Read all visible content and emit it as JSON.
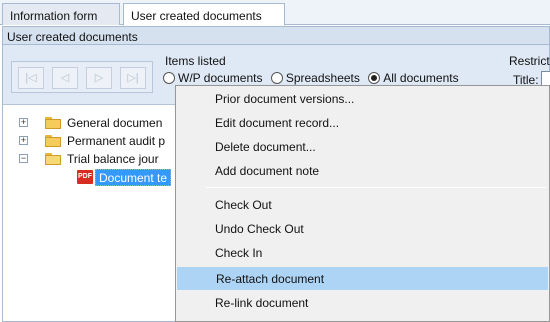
{
  "tabs": [
    {
      "label": "Information form",
      "active": false
    },
    {
      "label": "User created documents",
      "active": true,
      "caret": "▼"
    }
  ],
  "panel": {
    "title": "User created documents",
    "items_listed_label": "Items listed",
    "restricted_label": "Restricte",
    "radio_options": [
      {
        "label": "W/P documents",
        "checked": false
      },
      {
        "label": "Spreadsheets",
        "checked": false
      },
      {
        "label": "All documents",
        "checked": true
      }
    ],
    "title_field_label": "Title:",
    "nav_buttons": [
      "first",
      "previous",
      "next",
      "last"
    ]
  },
  "tree": {
    "nodes": [
      {
        "label": "General documen",
        "expander": "+",
        "icon": "folder-icon"
      },
      {
        "label": "Permanent audit p",
        "expander": "+",
        "icon": "folder-icon"
      },
      {
        "label": "Trial balance jour",
        "expander": "−",
        "icon": "folder-open-icon"
      },
      {
        "label": "Document te",
        "icon": "pdf-icon",
        "icon_text": "PDF",
        "selected": true
      }
    ]
  },
  "context_menu": {
    "items": [
      {
        "label": "Prior document versions..."
      },
      {
        "label": "Edit document record..."
      },
      {
        "label": "Delete document..."
      },
      {
        "label": "Add document note"
      },
      {
        "label": "Check Out"
      },
      {
        "label": "Undo Check Out"
      },
      {
        "label": "Check In"
      },
      {
        "label": "Re-attach document",
        "highlighted": true
      },
      {
        "label": "Re-link document"
      }
    ]
  },
  "colors": {
    "selection": "#3399ff",
    "menu_highlight": "#aed4f5",
    "panel_header": "#d6e1f0"
  }
}
